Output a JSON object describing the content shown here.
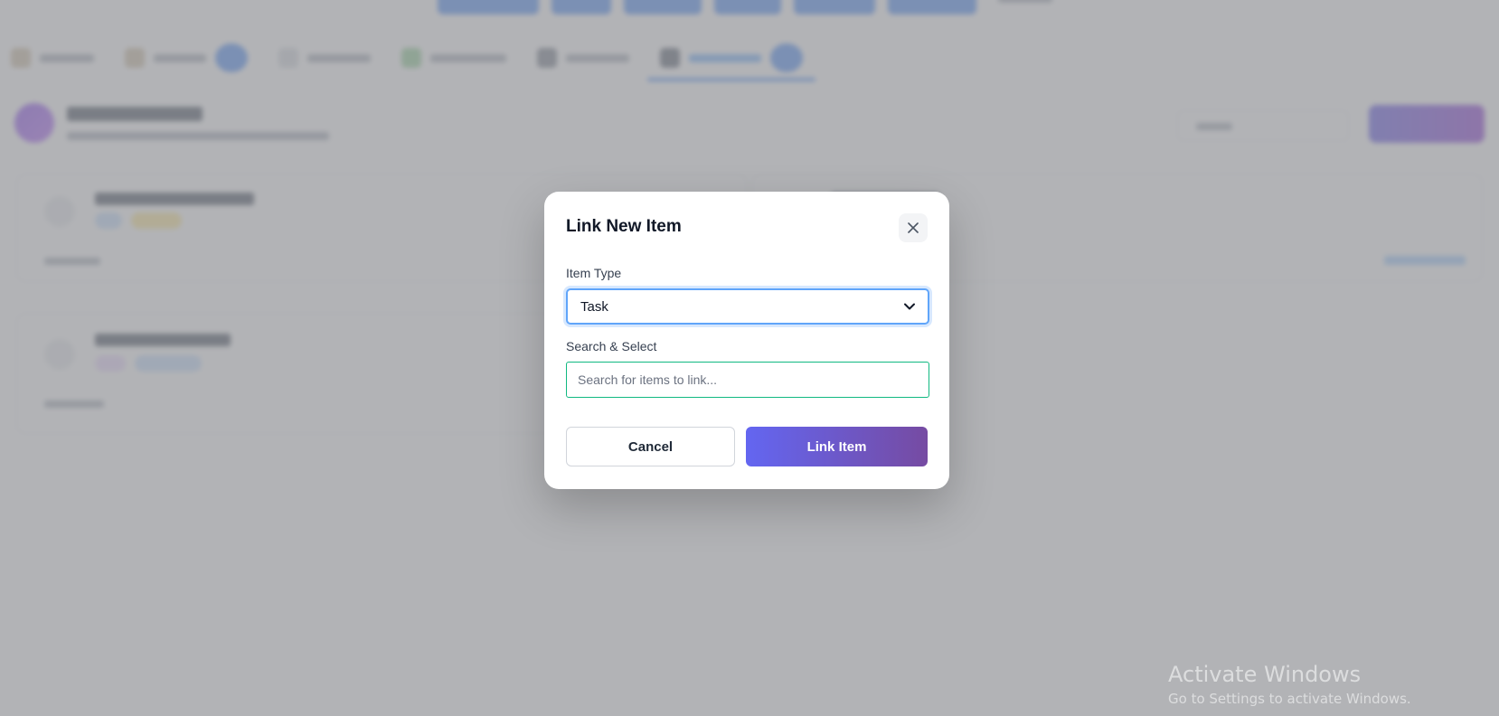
{
  "modal": {
    "title": "Link New Item",
    "item_type_label": "Item Type",
    "item_type_selected": "Task",
    "search_label": "Search & Select",
    "search_placeholder": "Search for items to link...",
    "search_value": "",
    "cancel_label": "Cancel",
    "submit_label": "Link Item",
    "close_icon": "close-icon"
  },
  "watermark": {
    "title": "Activate Windows",
    "subtitle": "Go to Settings to activate Windows."
  },
  "colors": {
    "primary_gradient_start": "#6366f1",
    "primary_gradient_end": "#764ba2",
    "select_focus": "#60a5fa",
    "search_border": "#10b981",
    "overlay": "#94969a"
  }
}
